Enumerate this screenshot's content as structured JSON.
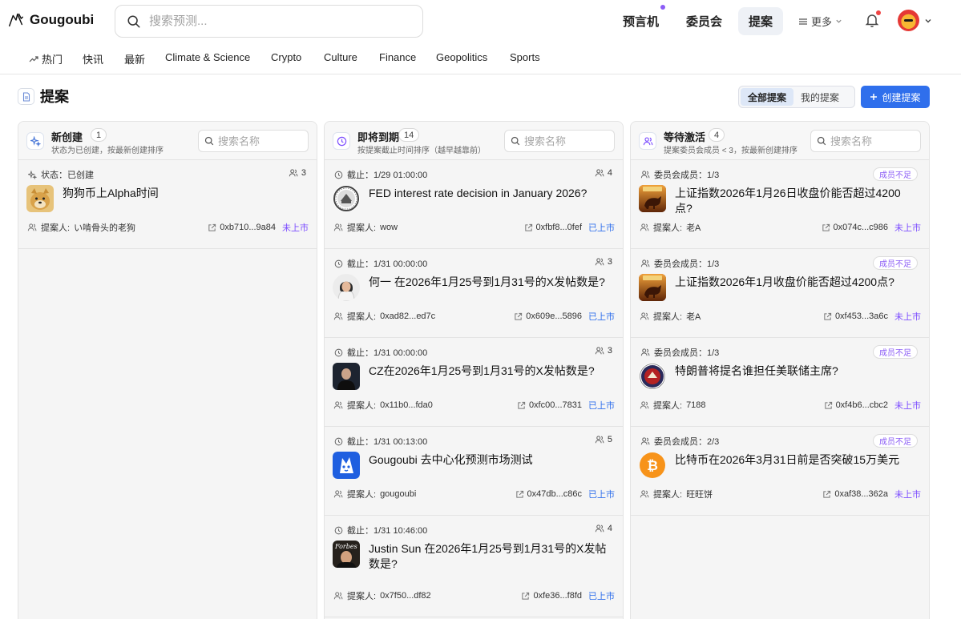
{
  "app": {
    "name": "Gougoubi"
  },
  "search": {
    "placeholder": "搜索预测..."
  },
  "nav": {
    "items": [
      "预言机",
      "委员会",
      "提案"
    ],
    "active": "提案",
    "more_label": "更多"
  },
  "categories": [
    "热门",
    "快讯",
    "最新",
    "Climate & Science",
    "Crypto",
    "Culture",
    "Finance",
    "Geopolitics",
    "Sports"
  ],
  "page": {
    "title": "提案",
    "tab_all": "全部提案",
    "tab_mine": "我的提案",
    "create_label": "创建提案"
  },
  "columns": [
    {
      "title": "新创建",
      "count": "1",
      "subtitle": "状态为已创建，按最新创建排序",
      "search_placeholder": "搜索名称",
      "cards": [
        {
          "meta_label": "状态：已创建",
          "members": "3",
          "question": "狗狗币上Alpha时间",
          "proposer_label": "提案人:",
          "proposer": "い啃骨头的老狗",
          "address": "0xb710...9a84",
          "status": "未上市",
          "thumb": "doge"
        }
      ]
    },
    {
      "title": "即将到期",
      "count": "14",
      "subtitle": "按提案截止时间排序（越早越靠前）",
      "search_placeholder": "搜索名称",
      "cards": [
        {
          "meta_label": "截止：1/29 01:00:00",
          "members": "4",
          "question": "FED interest rate decision in January 2026?",
          "proposer_label": "提案人:",
          "proposer": "wow",
          "address": "0xfbf8...0fef",
          "status": "已上市",
          "thumb": "fed"
        },
        {
          "meta_label": "截止：1/31 00:00:00",
          "members": "3",
          "question": "何一 在2026年1月25号到1月31号的X发帖数是?",
          "proposer_label": "提案人:",
          "proposer": "0xad82...ed7c",
          "address": "0x609e...5896",
          "status": "已上市",
          "thumb": "woman"
        },
        {
          "meta_label": "截止：1/31 00:00:00",
          "members": "3",
          "question": "CZ在2026年1月25号到1月31号的X发帖数是?",
          "proposer_label": "提案人:",
          "proposer": "0x11b0...fda0",
          "address": "0xfc00...7831",
          "status": "已上市",
          "thumb": "cz"
        },
        {
          "meta_label": "截止：1/31 00:13:00",
          "members": "5",
          "question": "Gougoubi 去中心化预测市场测试",
          "proposer_label": "提案人:",
          "proposer": "gougoubi",
          "address": "0x47db...c86c",
          "status": "已上市",
          "thumb": "gougoubi"
        },
        {
          "meta_label": "截止：1/31 10:46:00",
          "members": "4",
          "question": "Justin Sun 在2026年1月25号到1月31号的X发帖数是?",
          "proposer_label": "提案人:",
          "proposer": "0x7f50...df82",
          "address": "0xfe36...f8fd",
          "status": "已上市",
          "thumb": "forbes"
        }
      ]
    },
    {
      "title": "等待激活",
      "count": "4",
      "subtitle": "提案委员会成员 < 3，按最新创建排序",
      "search_placeholder": "搜索名称",
      "cards": [
        {
          "meta_label": "委员会成员：1/3",
          "badge": "成员不足",
          "question": "上证指数2026年1月26日收盘价能否超过4200点?",
          "proposer_label": "提案人:",
          "proposer": "老A",
          "address": "0x074c...c986",
          "status": "未上市",
          "thumb": "bull"
        },
        {
          "meta_label": "委员会成员：1/3",
          "badge": "成员不足",
          "question": "上证指数2026年1月收盘价能否超过4200点?",
          "proposer_label": "提案人:",
          "proposer": "老A",
          "address": "0xf453...3a6c",
          "status": "未上市",
          "thumb": "bull"
        },
        {
          "meta_label": "委员会成员：1/3",
          "badge": "成员不足",
          "question": "特朗普将提名谁担任美联储主席?",
          "proposer_label": "提案人:",
          "proposer": "7188",
          "address": "0xf4b6...cbc2",
          "status": "未上市",
          "thumb": "fed2"
        },
        {
          "meta_label": "委员会成员：2/3",
          "badge": "成员不足",
          "question": "比特币在2026年3月31日前是否突破15万美元",
          "proposer_label": "提案人:",
          "proposer": "旺旺饼",
          "address": "0xaf38...362a",
          "status": "未上市",
          "thumb": "btc"
        }
      ]
    }
  ],
  "colors": {
    "accent": "#2f6fec",
    "listed": "#2f6fec",
    "unlisted": "#7c4dff",
    "badge": "#8b5cf6"
  }
}
